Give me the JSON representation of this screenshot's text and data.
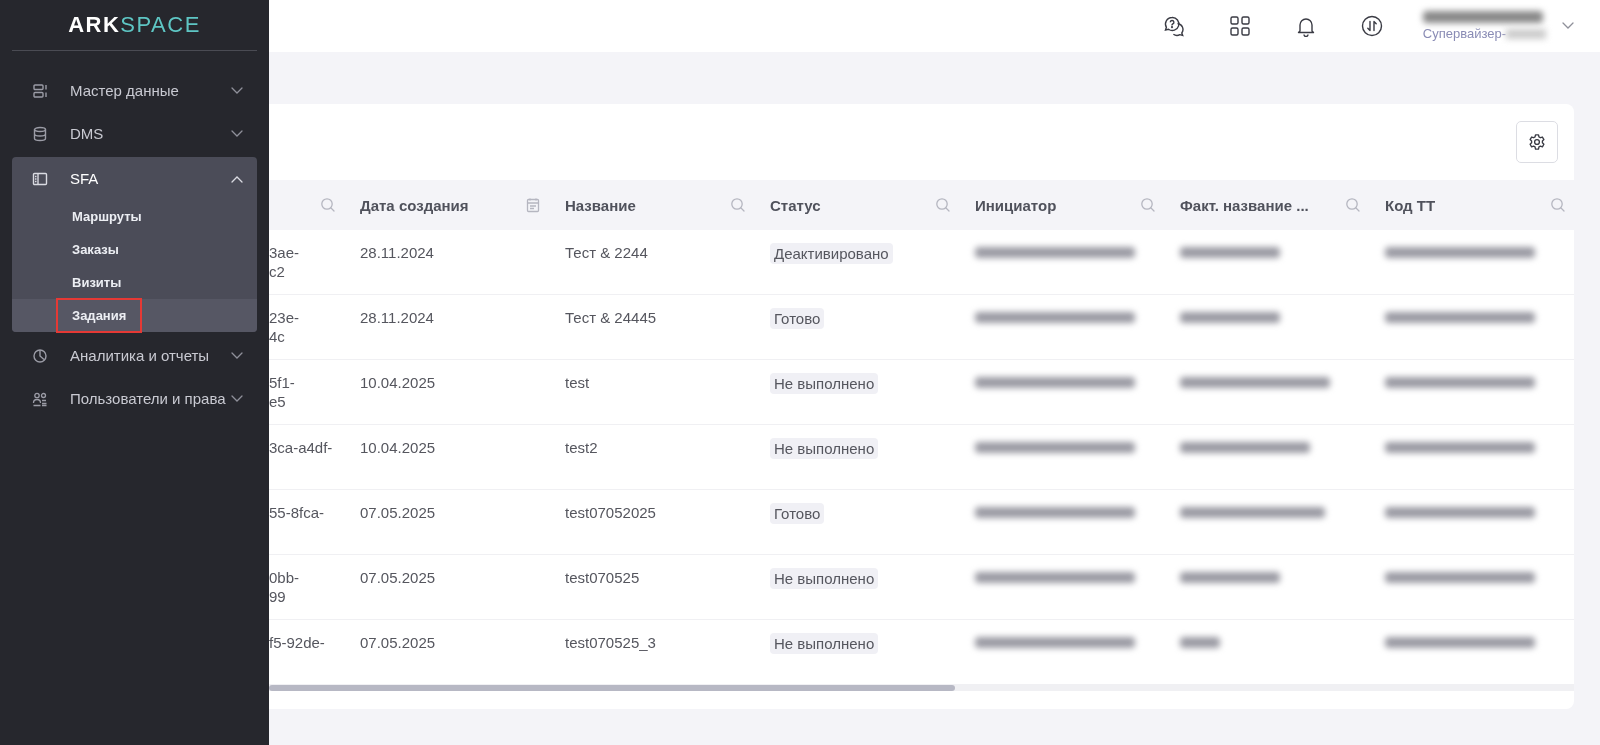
{
  "logo": {
    "brand_left": "ARK",
    "brand_right": "SPACE"
  },
  "sidebar": {
    "items": [
      {
        "label": "Мастер данные",
        "expanded": false
      },
      {
        "label": "DMS",
        "expanded": false
      },
      {
        "label": "SFA",
        "expanded": true,
        "children": [
          {
            "label": "Маршруты",
            "selected": false
          },
          {
            "label": "Заказы",
            "selected": false
          },
          {
            "label": "Визиты",
            "selected": false
          },
          {
            "label": "Задания",
            "selected": true
          }
        ]
      },
      {
        "label": "Аналитика и отчеты",
        "expanded": false
      },
      {
        "label": "Пользователи и права",
        "expanded": false
      }
    ]
  },
  "header": {
    "user": {
      "role": "Супервайзер-"
    }
  },
  "table": {
    "columns": [
      {},
      {
        "label": "Дата создания"
      },
      {
        "label": "Название"
      },
      {
        "label": "Статус"
      },
      {
        "label": "Инициатор"
      },
      {
        "label": "Факт. название ..."
      },
      {
        "label": "Код ТТ"
      }
    ],
    "rows": [
      {
        "column_1": [
          "3ae-",
          "c2"
        ],
        "date": "28.11.2024",
        "name": "Тест & 2244",
        "status": "Деактивировано"
      },
      {
        "column_1": [
          "23e-",
          "4c"
        ],
        "date": "28.11.2024",
        "name": "Тест & 24445",
        "status": "Готово"
      },
      {
        "column_1": [
          "5f1-",
          "e5"
        ],
        "date": "10.04.2025",
        "name": "test",
        "status": "Не выполнено"
      },
      {
        "column_1": [
          "3ca-a4df-"
        ],
        "date": "10.04.2025",
        "name": "test2",
        "status": "Не выполнено"
      },
      {
        "column_1": [
          "55-8fca-"
        ],
        "date": "07.05.2025",
        "name": "test07052025",
        "status": "Готово"
      },
      {
        "column_1": [
          "0bb-",
          "99"
        ],
        "date": "07.05.2025",
        "name": "test070525",
        "status": "Не выполнено"
      },
      {
        "column_1": [
          "f5-92de-"
        ],
        "date": "07.05.2025",
        "name": "test070525_3",
        "status": "Не выполнено"
      }
    ]
  }
}
